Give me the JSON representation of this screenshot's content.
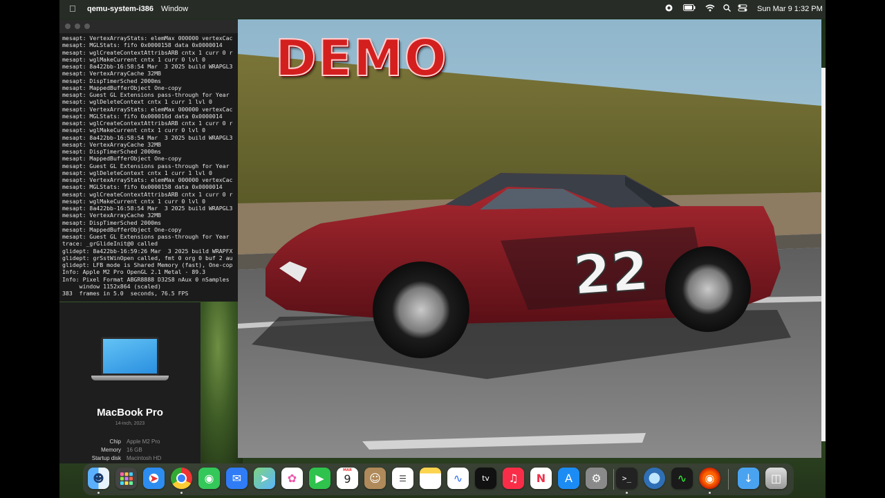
{
  "menubar": {
    "app_name": "qemu-system-i386",
    "menu_window": "Window",
    "clock": "Sun Mar 9  1:32 PM",
    "icons": [
      "apple-icon",
      "record-icon",
      "battery-icon",
      "wifi-icon",
      "search-icon",
      "control-center-icon"
    ]
  },
  "terminal": {
    "lines": [
      "mesapt: VertexArrayStats: elemMax 000000 vertexCac",
      "mesapt: MGLStats: fifo 0x0000158 data 0x0000014",
      "mesapt: wglCreateContextAttribsARB cntx 1 curr 0 r",
      "mesapt: wglMakeCurrent cntx 1 curr 0 lvl 0",
      "mesapt: 8a422bb-16:58:54 Mar  3 2025 build WRAPGL3",
      "mesapt: VertexArrayCache 32MB",
      "mesapt: DispTimerSched 2000ms",
      "mesapt: MappedBufferObject One-copy",
      "mesapt: Guest GL Extensions pass-through for Year",
      "mesapt: wglDeleteContext cntx 1 curr 1 lvl 0",
      "mesapt: VertexArrayStats: elemMax 000000 vertexCac",
      "mesapt: MGLStats: fifo 0x000016d data 0x0000014",
      "mesapt: wglCreateContextAttribsARB cntx 1 curr 0 r",
      "mesapt: wglMakeCurrent cntx 1 curr 0 lvl 0",
      "mesapt: 8a422bb-16:58:54 Mar  3 2025 build WRAPGL3",
      "mesapt: VertexArrayCache 32MB",
      "mesapt: DispTimerSched 2000ms",
      "mesapt: MappedBufferObject One-copy",
      "mesapt: Guest GL Extensions pass-through for Year",
      "mesapt: wglDeleteContext cntx 1 curr 1 lvl 0",
      "mesapt: VertexArrayStats: elemMax 000000 vertexCac",
      "mesapt: MGLStats: fifo 0x0000158 data 0x0000014",
      "mesapt: wglCreateContextAttribsARB cntx 1 curr 0 r",
      "mesapt: wglMakeCurrent cntx 1 curr 0 lvl 0",
      "mesapt: 8a422bb-16:58:54 Mar  3 2025 build WRAPGL3",
      "mesapt: VertexArrayCache 32MB",
      "mesapt: DispTimerSched 2000ms",
      "mesapt: MappedBufferObject One-copy",
      "mesapt: Guest GL Extensions pass-through for Year",
      "trace: _grGlideInit@0 called",
      "glidept: 8a422bb-16:59:26 Mar  3 2025 build WRAPFX",
      "glidept: grSstWinOpen called, fmt 0 org 0 buf 2 au",
      "glidept: LFB mode is Shared Memory (fast), One-cop",
      "Info: Apple M2 Pro OpenGL 2.1 Metal - 89.3",
      "Info: Pixel Format ABGR8888 D32S8 nAux 0 nSamples",
      "     window 1152x864 (scaled)",
      "383  frames in 5.0  seconds, 76.5 FPS"
    ]
  },
  "about": {
    "title": "MacBook Pro",
    "subtitle": "14-inch, 2023",
    "specs": [
      {
        "key": "Chip",
        "value": "Apple M2 Pro"
      },
      {
        "key": "Memory",
        "value": "16 GB"
      },
      {
        "key": "Startup disk",
        "value": "Macintosh HD"
      }
    ]
  },
  "game": {
    "banner": "DEMO",
    "car_number": "22",
    "colors": {
      "sky": "#a9c8d6",
      "hill": "#6b6a2f",
      "road": "#6e6e6e",
      "car": "#8c1b22"
    }
  },
  "dock": {
    "calendar_month": "MAR",
    "calendar_day": "9",
    "items": [
      "finder-icon",
      "launchpad-icon",
      "safari-icon",
      "chrome-icon",
      "messages-icon",
      "mail-icon",
      "maps-icon",
      "photos-icon",
      "facetime-icon",
      "calendar-icon",
      "contacts-icon",
      "reminders-icon",
      "notes-icon",
      "freeform-icon",
      "tv-icon",
      "music-icon",
      "news-icon",
      "app-store-icon",
      "system-settings-icon",
      "terminal-icon",
      "quicktime-icon",
      "activity-monitor-icon",
      "qemu-icon",
      "downloads-icon",
      "trash-icon"
    ]
  }
}
